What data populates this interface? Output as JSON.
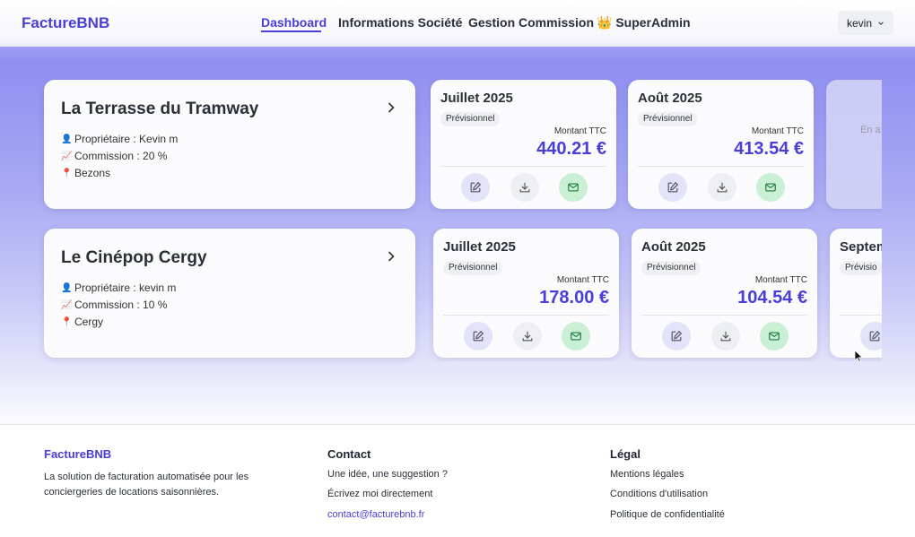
{
  "header": {
    "brand": "FactureBNB",
    "nav": [
      {
        "label": "Dashboard",
        "active": true
      },
      {
        "label": "Informations Société",
        "active": false
      },
      {
        "label": "Gestion Commission",
        "active": false
      },
      {
        "label": "👑 SuperAdmin",
        "active": false
      }
    ],
    "user": "kevin"
  },
  "properties": [
    {
      "name": "La Terrasse du Tramway",
      "owner": "Propriétaire : Kevin m",
      "commission": "Commission : 20 %",
      "city": "Bezons",
      "invoices": [
        {
          "month": "Juillet 2025",
          "status": "Prévisionnel",
          "amount_label": "Montant TTC",
          "amount": "440.21 €"
        },
        {
          "month": "Août 2025",
          "status": "Prévisionnel",
          "amount_label": "Montant TTC",
          "amount": "413.54 €"
        },
        {
          "pending": "En a"
        }
      ]
    },
    {
      "name": "Le Cinépop Cergy",
      "owner": "Propriétaire : kevin m",
      "commission": "Commission : 10 %",
      "city": "Cergy",
      "invoices": [
        {
          "month": "Juillet 2025",
          "status": "Prévisionnel",
          "amount_label": "Montant TTC",
          "amount": "178.00 €"
        },
        {
          "month": "Août 2025",
          "status": "Prévisionnel",
          "amount_label": "Montant TTC",
          "amount": "104.54 €"
        },
        {
          "month": "Septem",
          "status": "Prévisio"
        }
      ]
    }
  ],
  "footer": {
    "brand": "FactureBNB",
    "tagline_1": "La solution de facturation automatisée pour les",
    "tagline_2": "conciergeries de locations saisonnières.",
    "contact_title": "Contact",
    "contact_1": "Une idée, une suggestion ?",
    "contact_2": "Écrivez moi directement",
    "contact_email": "contact@facturebnb.fr",
    "legal_title": "Légal",
    "legal_1": "Mentions légales",
    "legal_2": "Conditions d'utilisation",
    "legal_3": "Politique de confidentialité"
  },
  "icons": {
    "edit": "pencil-square-icon",
    "download": "download-icon",
    "mail": "mail-icon",
    "owner": "person-icon",
    "commission": "chart-icon",
    "city": "pin-icon"
  },
  "colors": {
    "accent": "#4a3ed6",
    "mail_bg": "#c9f0d4",
    "edit_bg": "#e2e3f8"
  }
}
